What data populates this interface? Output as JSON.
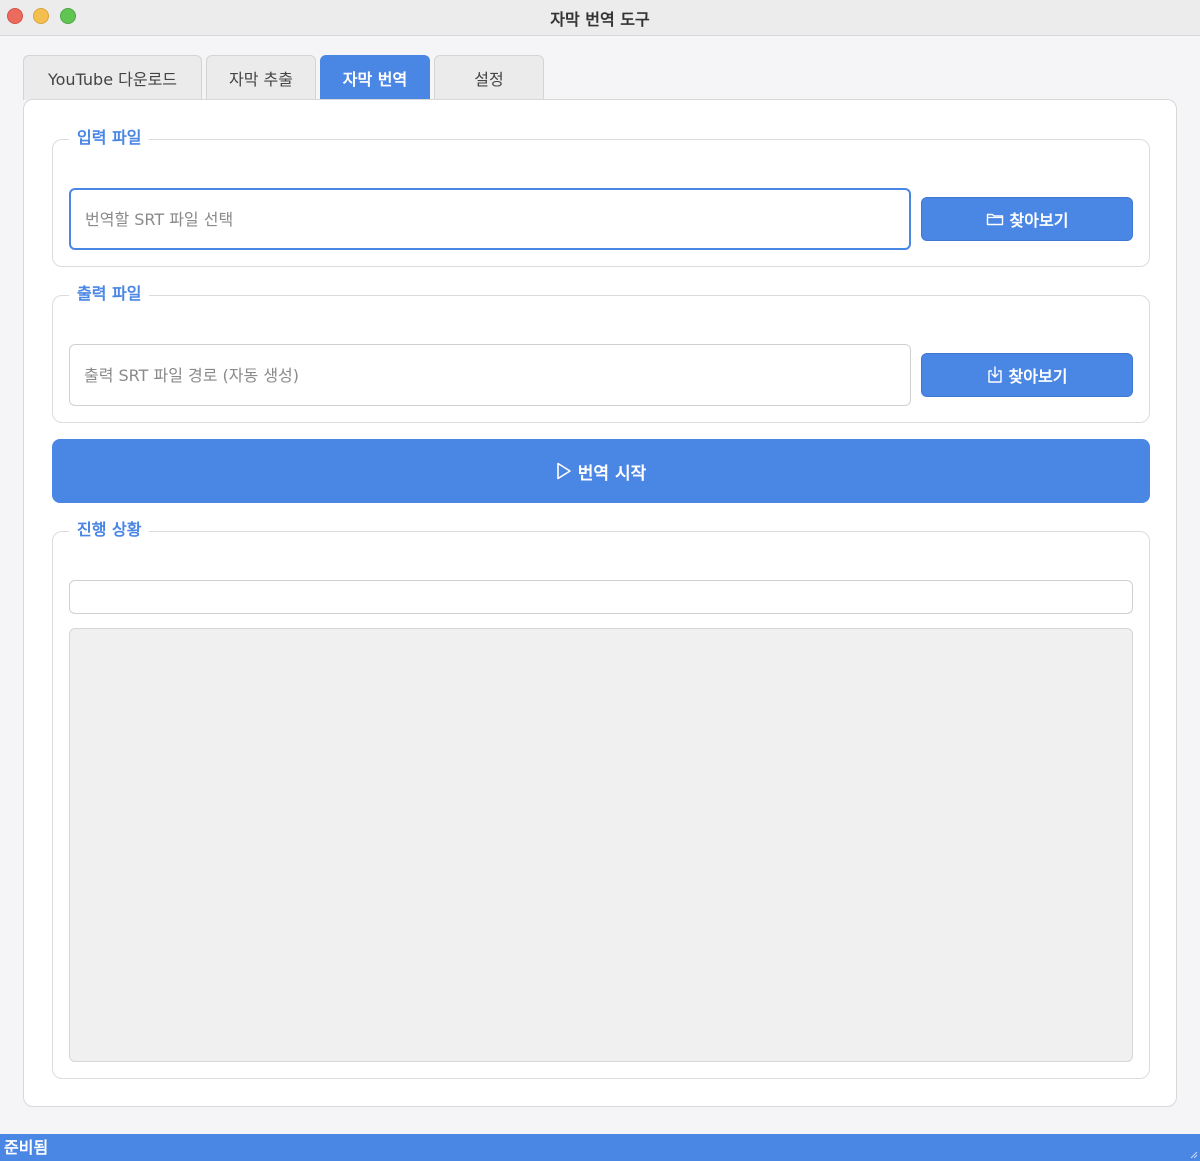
{
  "window": {
    "title": "자막 번역 도구"
  },
  "tabs": [
    {
      "label": "YouTube 다운로드",
      "active": false
    },
    {
      "label": "자막 추출",
      "active": false
    },
    {
      "label": "자막 번역",
      "active": true
    },
    {
      "label": "설정",
      "active": false
    }
  ],
  "input_group": {
    "title": "입력 파일",
    "field_value": "",
    "field_placeholder": "번역할 SRT 파일 선택",
    "browse_label": "찾아보기",
    "browse_icon": "folder-icon"
  },
  "output_group": {
    "title": "출력 파일",
    "field_value": "",
    "field_placeholder": "출력 SRT 파일 경로 (자동 생성)",
    "browse_label": "찾아보기",
    "browse_icon": "save-icon"
  },
  "start_button": {
    "label": "번역 시작",
    "icon": "play-icon"
  },
  "progress_group": {
    "title": "진행 상황",
    "progress": 0,
    "log_text": ""
  },
  "status_bar": {
    "text": "준비됨"
  },
  "colors": {
    "accent": "#4a86e4",
    "background": "#f5f5f7",
    "log_background": "#f0f0f0"
  }
}
